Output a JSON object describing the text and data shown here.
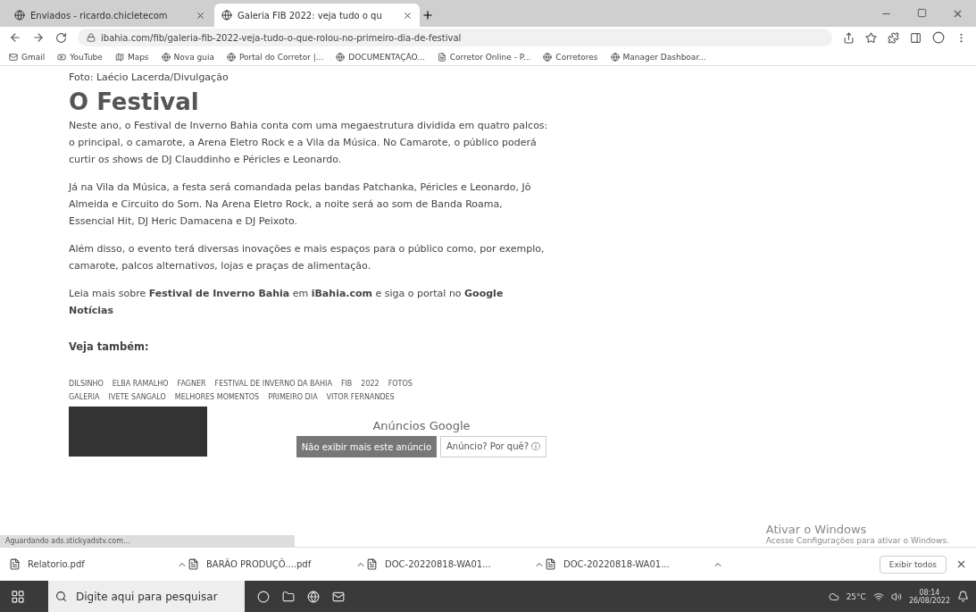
{
  "tabs": [
    {
      "title": "Enviados - ricardo.chicletecom",
      "selected": false
    },
    {
      "title": "Galeria FIB 2022: veja tudo o qu",
      "selected": true
    }
  ],
  "address_bar": {
    "url": "ibahia.com/fib/galeria-fib-2022-veja-tudo-o-que-rolou-no-primeiro-dia-de-festival"
  },
  "bookmarks": [
    "Gmail",
    "YouTube",
    "Maps",
    "Nova guia",
    "Portal do Corretor |...",
    "DOCUMENTAÇÃO...",
    "Corretor Online - P...",
    "Corretores",
    "Manager Dashboar..."
  ],
  "article": {
    "photo_credit": "Foto: Laécio Lacerda/Divulgação",
    "heading": "O Festival",
    "paragraphs": [
      "Neste ano, o Festival de Inverno Bahia conta com uma megaestrutura dividida em quatro palcos: o principal, o camarote, a Arena Eletro Rock e a Vila da Música. No Camarote, o público poderá curtir os shows de DJ Clauddinho e Péricles e Leonardo.",
      "Já na Vila da Música, a festa será comandada pelas bandas Patchanka, Péricles e Leonardo, Jô Almeida e Circuito do Som. Na Arena Eletro Rock, a noite será ao som de Banda Roama, Essencial Hit, DJ Heric Damacena e DJ Peixoto.",
      "Além disso, o evento terá diversas inovações e mais espaços para o público como, por exemplo, camarote, palcos alternativos, lojas e praças de alimentação.",
      "Leia mais sobre **Festival de Inverno Bahia** em **iBahia.com** e siga o portal no **Google Notícias**"
    ],
    "see_also": "Veja também:",
    "tags": [
      "DILSINHO",
      "ELBA RAMALHO",
      "FAGNER",
      "FESTIVAL DE INVERNO DA BAHIA",
      "FIB",
      "2022",
      "FOTOS",
      "GALERIA",
      "IVETE SANGALO",
      "MELHORES MOMENTOS",
      "PRIMEIRO DIA",
      "VITOR FERNANDES"
    ]
  },
  "ad": {
    "title": "Anúncios Google",
    "stop_button": "Não exibir mais este anúncio",
    "why_button": "Anúncio? Por quê? ⓘ"
  },
  "status": "Aguardando ads.stickyadstv.com...",
  "activation": {
    "title": "Ativar o Windows",
    "subtitle": "Acesse Configurações para ativar o Windows."
  },
  "downloads": {
    "files": [
      "Relatorio.pdf",
      "BARÃO PRODUÇÕ....pdf",
      "DOC-20220818-WA01...",
      "DOC-20220818-WA01..."
    ],
    "show_all": "Exibir todos"
  },
  "taskbar": {
    "search_placeholder": "Digite aqui para pesquisar",
    "temperature": "25°C",
    "time": "08:14",
    "date": "26/08/2022"
  }
}
